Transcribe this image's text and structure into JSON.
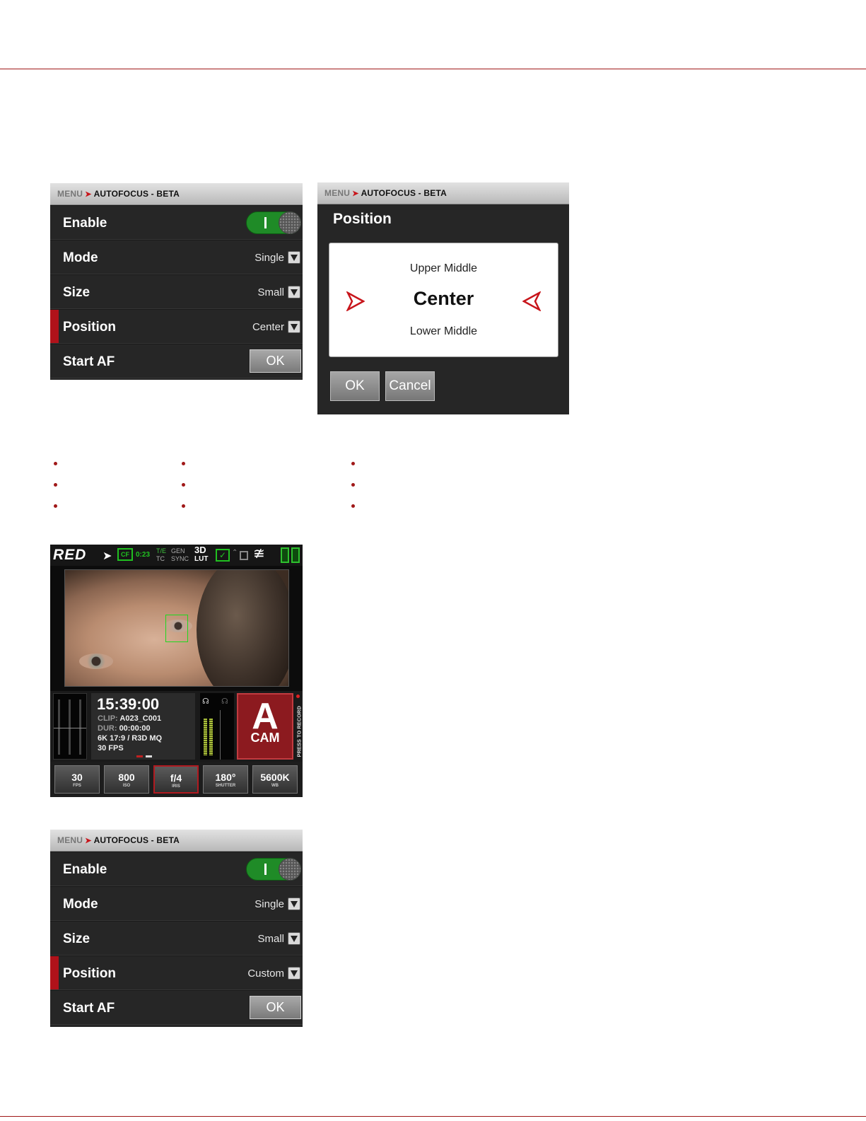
{
  "menu_panel_1": {
    "crumb_menu": "MENU",
    "crumb_title": "AUTOFOCUS - BETA",
    "rows": {
      "enable": {
        "label": "Enable"
      },
      "mode": {
        "label": "Mode",
        "value": "Single"
      },
      "size": {
        "label": "Size",
        "value": "Small"
      },
      "position": {
        "label": "Position",
        "value": "Center"
      },
      "start_af": {
        "label": "Start AF",
        "button": "OK"
      }
    }
  },
  "position_dialog": {
    "crumb_menu": "MENU",
    "crumb_title": "AUTOFOCUS - BETA",
    "title": "Position",
    "options": {
      "above": "Upper Middle",
      "selected": "Center",
      "below": "Lower Middle"
    },
    "ok": "OK",
    "cancel": "Cancel"
  },
  "camera_screen": {
    "logo": "RED",
    "status": {
      "media": "CF",
      "media_time": "0:23",
      "te": "T/E",
      "tc": "TC",
      "gen": "GEN",
      "sync": "SYNC",
      "lut_top": "3D",
      "lut_bottom": "LUT"
    },
    "timecode": "15:39:00",
    "clip_key": "CLIP:",
    "clip": "A023_C001",
    "dur_key": "DUR:",
    "dur": "00:00:00",
    "format": "6K 17:9 / R3D MQ",
    "fps_line": "30 FPS",
    "record_letter": "A",
    "record_label": "CAM",
    "press_to_record": "PRESS TO RECORD",
    "buttons": [
      {
        "value": "30",
        "unit": "FPS"
      },
      {
        "value": "800",
        "unit": "ISO"
      },
      {
        "value": "f/4",
        "unit": "IRIS"
      },
      {
        "value": "180°",
        "unit": "SHUTTER"
      },
      {
        "value": "5600K",
        "unit": "WB"
      }
    ]
  },
  "menu_panel_2": {
    "crumb_menu": "MENU",
    "crumb_title": "AUTOFOCUS - BETA",
    "rows": {
      "enable": {
        "label": "Enable"
      },
      "mode": {
        "label": "Mode",
        "value": "Single"
      },
      "size": {
        "label": "Size",
        "value": "Small"
      },
      "position": {
        "label": "Position",
        "value": "Custom"
      },
      "start_af": {
        "label": "Start AF",
        "button": "OK"
      }
    }
  },
  "colors": {
    "accent": "#a01818",
    "toggle_on": "#1f8b27",
    "record": "#8c1a1f",
    "af_box": "#1fd81f"
  }
}
